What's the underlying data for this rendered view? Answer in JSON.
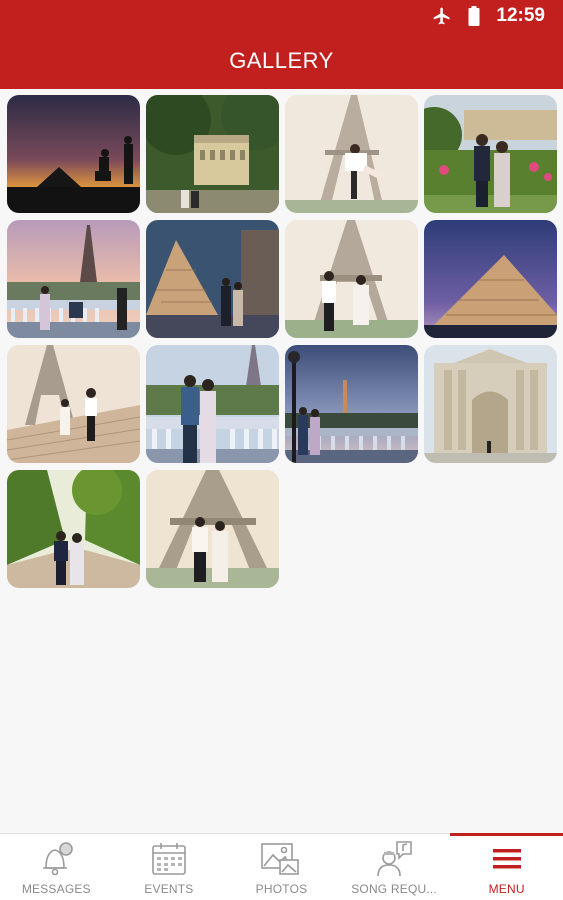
{
  "status_bar": {
    "time": "12:59",
    "icons": [
      "airplane-icon",
      "battery-icon"
    ]
  },
  "header": {
    "title": "GALLERY",
    "color": "#c2201f"
  },
  "gallery": {
    "photos": [
      {
        "name": "photo-proposal-silhouette-pyramid",
        "scene": "silhouette proposal at dusk near Louvre pyramid"
      },
      {
        "name": "photo-couple-garden-palace",
        "scene": "couple in park with palace facade"
      },
      {
        "name": "photo-eiffel-dip-kiss",
        "scene": "couple dip pose under Eiffel Tower"
      },
      {
        "name": "photo-couple-garden-flowers",
        "scene": "couple in flower garden"
      },
      {
        "name": "photo-proposal-bridge-eiffel",
        "scene": "proposal on bridge with Eiffel Tower"
      },
      {
        "name": "photo-louvre-pyramid-couple",
        "scene": "couple at Louvre pyramid"
      },
      {
        "name": "photo-eiffel-couple-walk",
        "scene": "couple under Eiffel Tower"
      },
      {
        "name": "photo-louvre-pyramid-night",
        "scene": "Louvre pyramid at twilight"
      },
      {
        "name": "photo-eiffel-stairs-couple",
        "scene": "couple on stairs with Eiffel Tower"
      },
      {
        "name": "photo-couple-bridge-eiffel",
        "scene": "couple on bridge with Eiffel Tower"
      },
      {
        "name": "photo-couple-lamppost-eiffel",
        "scene": "couple by lamppost at dusk"
      },
      {
        "name": "photo-stone-gate-building",
        "scene": "stone building gate"
      },
      {
        "name": "photo-couple-tree-alley",
        "scene": "couple in tree-lined alley"
      },
      {
        "name": "photo-eiffel-couple-standing",
        "scene": "couple standing before Eiffel Tower"
      }
    ]
  },
  "bottom_nav": {
    "items": [
      {
        "label": "MESSAGES",
        "icon": "bell-icon",
        "active": false
      },
      {
        "label": "EVENTS",
        "icon": "calendar-icon",
        "active": false
      },
      {
        "label": "PHOTOS",
        "icon": "photos-icon",
        "active": false
      },
      {
        "label": "SONG REQU...",
        "icon": "song-request-icon",
        "active": false
      },
      {
        "label": "MENU",
        "icon": "hamburger-menu-icon",
        "active": true
      }
    ],
    "accent_color": "#c2201f",
    "inactive_color": "#8a8a8a"
  }
}
